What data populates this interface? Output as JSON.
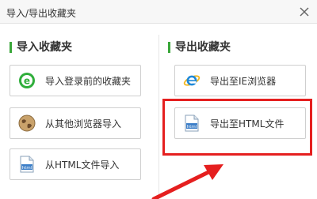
{
  "dialog": {
    "title": "导入/导出收藏夹"
  },
  "import_section": {
    "title": "导入收藏夹",
    "buttons": [
      {
        "label": "导入登录前的收藏夹",
        "icon": "browser-e-green-icon"
      },
      {
        "label": "从其他浏览器导入",
        "icon": "globe-icon"
      },
      {
        "label": "从HTML文件导入",
        "icon": "html-file-icon"
      }
    ]
  },
  "export_section": {
    "title": "导出收藏夹",
    "buttons": [
      {
        "label": "导出至IE浏览器",
        "icon": "ie-icon"
      },
      {
        "label": "导出至HTML文件",
        "icon": "html-file-icon"
      }
    ]
  },
  "colors": {
    "accent_green": "#3aa73a",
    "highlight_red": "#e51f1f"
  }
}
